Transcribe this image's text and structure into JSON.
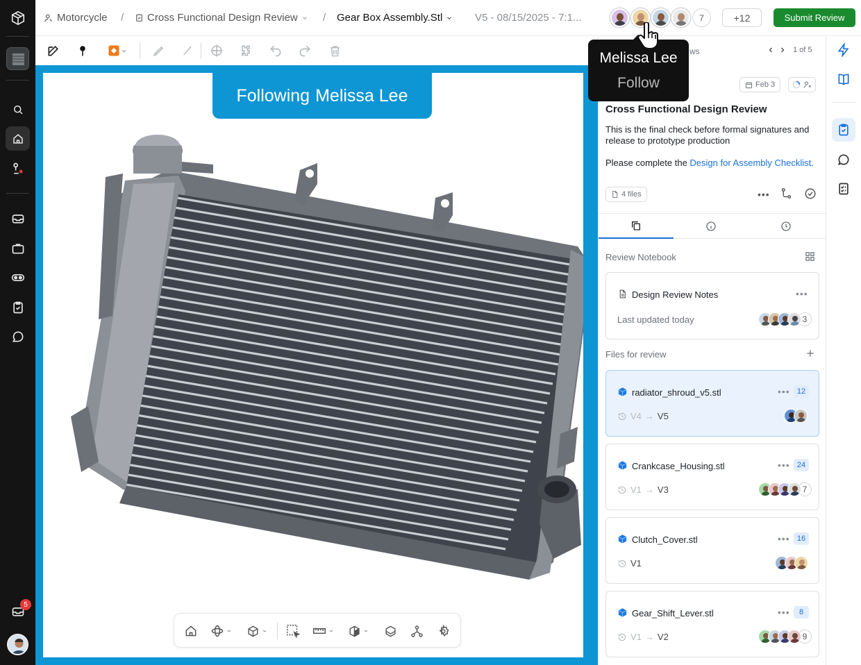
{
  "header": {
    "project": "Motorcycle",
    "review": "Cross Functional Design Review",
    "file": "Gear Box Assembly.Stl",
    "version": "V5 - 08/15/2025 - 7:1...",
    "viewer_count": "7",
    "extra_count": "+12",
    "submit_label": "Submit Review"
  },
  "left_rail": {
    "notification_count": "5"
  },
  "viewer": {
    "banner_prefix": "Following",
    "banner_name": "Melissa Lee"
  },
  "tooltip": {
    "name": "Melissa Lee",
    "action": "Follow"
  },
  "panel": {
    "partial_label": "ws",
    "pager": "1 of 5",
    "date_chip": "Feb 3",
    "title": "Cross Functional Design Review",
    "description": "This is the final check before formal signatures and release to prototype production",
    "desc2_prefix": "Please complete the ",
    "desc2_link": "Design for Assembly Checklist.",
    "files_chip": "4 files",
    "notebook_label": "Review Notebook",
    "notebook_card": {
      "title": "Design Review Notes",
      "updated": "Last updated today",
      "count": "3"
    },
    "files_label": "Files for review",
    "files": [
      {
        "name": "radiator_shroud_v5.stl",
        "badge": "12",
        "from": "V4",
        "to": "V5",
        "count": ""
      },
      {
        "name": "Crankcase_Housing.stl",
        "badge": "24",
        "from": "V1",
        "to": "V3",
        "count": "7"
      },
      {
        "name": "Clutch_Cover.stl",
        "badge": "16",
        "from": "",
        "to": "V1",
        "count": ""
      },
      {
        "name": "Gear_Shift_Lever.stl",
        "badge": "8",
        "from": "V1",
        "to": "V2",
        "count": "9"
      }
    ]
  },
  "colors": {
    "accent_blue": "#0e95d4",
    "submit_green": "#1a8a2f",
    "link_blue": "#1a6fd6",
    "rail_bg": "#141414"
  }
}
